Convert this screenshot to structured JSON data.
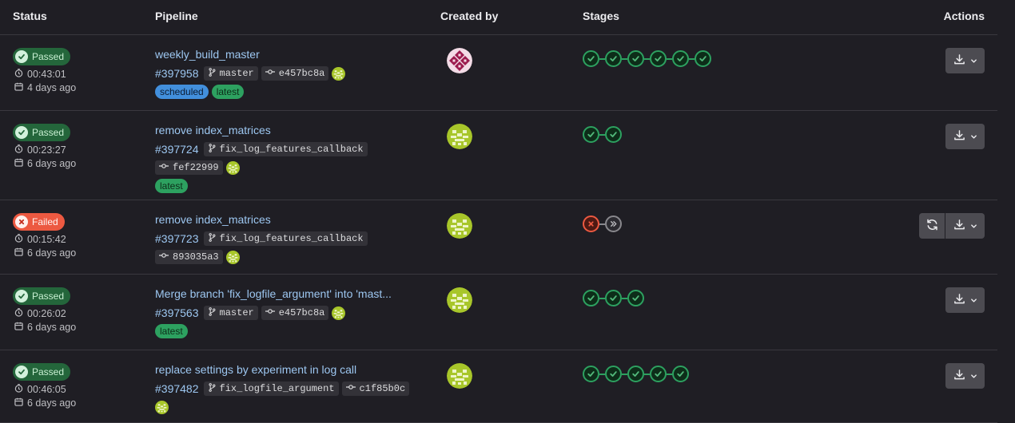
{
  "columns": {
    "status": "Status",
    "pipeline": "Pipeline",
    "created_by": "Created by",
    "stages": "Stages",
    "actions": "Actions"
  },
  "colors": {
    "passed": "#24663b",
    "failed": "#ec5941",
    "link": "#9dc7f1",
    "scheduled": "#428fdc",
    "latest": "#2da160"
  },
  "rows": [
    {
      "status": "Passed",
      "duration": "00:43:01",
      "finished": "4 days ago",
      "name": "weekly_build_master",
      "id": "#397958",
      "branch": "master",
      "commit": "e457bc8a",
      "tags": [
        "scheduled",
        "latest"
      ],
      "avatar": "maroon-identicon",
      "stages": [
        "success",
        "success",
        "success",
        "success",
        "success",
        "success"
      ],
      "retry": false
    },
    {
      "status": "Passed",
      "duration": "00:23:27",
      "finished": "6 days ago",
      "name": "remove index_matrices",
      "id": "#397724",
      "branch": "fix_log_features_callback",
      "commit": "fef22999",
      "tags": [
        "latest"
      ],
      "avatar": "green-identicon",
      "stages": [
        "success",
        "success"
      ],
      "retry": false
    },
    {
      "status": "Failed",
      "duration": "00:15:42",
      "finished": "6 days ago",
      "name": "remove index_matrices",
      "id": "#397723",
      "branch": "fix_log_features_callback",
      "commit": "893035a3",
      "tags": [],
      "avatar": "green-identicon",
      "stages": [
        "failed",
        "skipped"
      ],
      "retry": true
    },
    {
      "status": "Passed",
      "duration": "00:26:02",
      "finished": "6 days ago",
      "name": "Merge branch 'fix_logfile_argument' into 'mast...",
      "id": "#397563",
      "branch": "master",
      "commit": "e457bc8a",
      "tags": [
        "latest"
      ],
      "avatar": "green-identicon",
      "stages": [
        "success",
        "success",
        "success"
      ],
      "retry": false
    },
    {
      "status": "Passed",
      "duration": "00:46:05",
      "finished": "6 days ago",
      "name": "replace settings by experiment in log call",
      "id": "#397482",
      "branch": "fix_logfile_argument",
      "commit": "c1f85b0c",
      "tags": [],
      "avatar": "green-identicon",
      "stages": [
        "success",
        "success",
        "success",
        "success",
        "success"
      ],
      "retry": false
    }
  ]
}
